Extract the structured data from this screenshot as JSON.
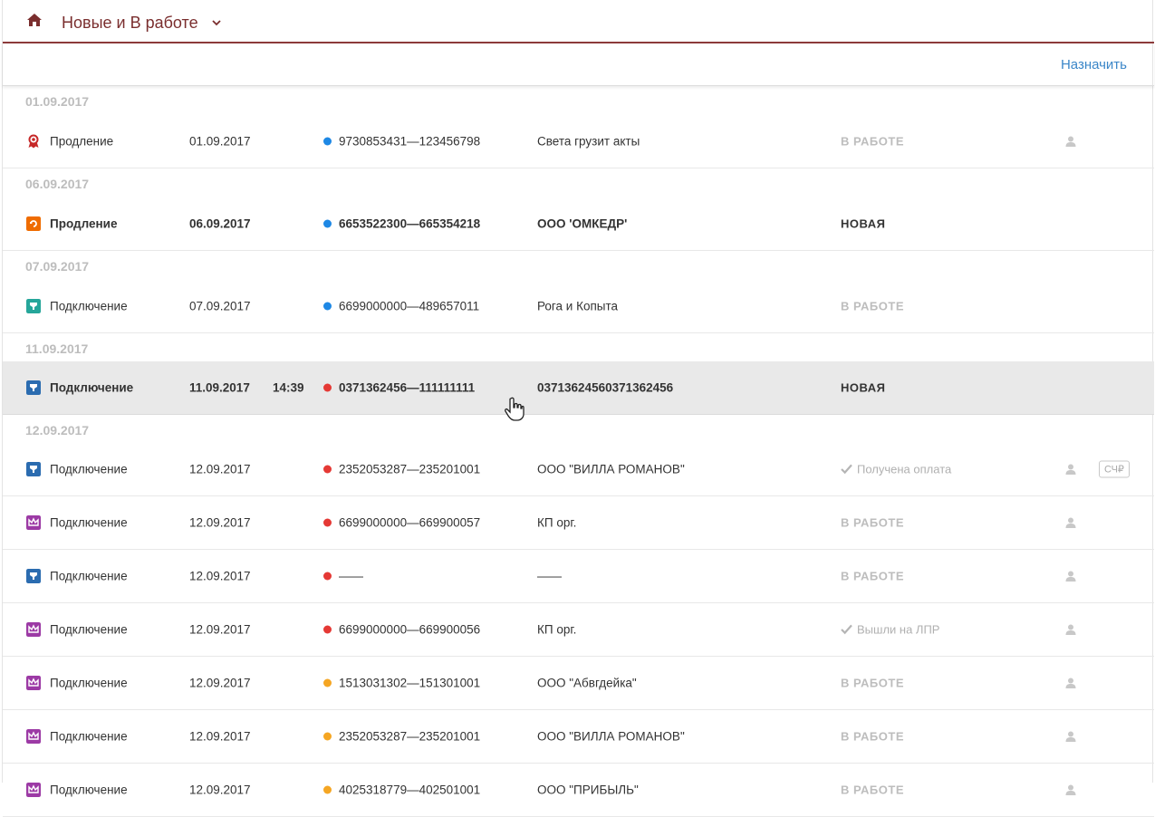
{
  "header": {
    "title": "Новые и В работе",
    "icons": [
      "home-icon",
      "chevron-down-icon"
    ]
  },
  "actions": {
    "assign_label": "Назначить"
  },
  "colors": {
    "brand": "#7a2e2e",
    "link": "#3a86c8",
    "dot_blue": "#1e88e5",
    "dot_red": "#e53935",
    "dot_orange": "#f5a623",
    "icon_red": "#c62828",
    "icon_orange": "#ef6c00",
    "icon_green": "#26a69a",
    "icon_blue": "#2b6cb0",
    "icon_purple": "#9c3aa5"
  },
  "groups": [
    {
      "date": "01.09.2017",
      "rows": [
        {
          "icon": "award-icon",
          "icon_color": "icon_red",
          "type": "Продление",
          "date": "01.09.2017",
          "time": "",
          "dot": "dot_blue",
          "inn": "9730853431—123456798",
          "org": "Света грузит акты",
          "status": "В РАБОТЕ",
          "status_kind": "work",
          "user": true,
          "badge": "",
          "bold": false,
          "selected": false
        }
      ]
    },
    {
      "date": "06.09.2017",
      "rows": [
        {
          "icon": "renew-icon",
          "icon_color": "icon_orange",
          "type": "Продление",
          "date": "06.09.2017",
          "time": "",
          "dot": "dot_blue",
          "inn": "6653522300—665354218",
          "org": "ООО 'ОМКЕДР'",
          "status": "НОВАЯ",
          "status_kind": "new",
          "user": false,
          "badge": "",
          "bold": true,
          "selected": false
        }
      ]
    },
    {
      "date": "07.09.2017",
      "rows": [
        {
          "icon": "connect-icon",
          "icon_color": "icon_green",
          "type": "Подключение",
          "date": "07.09.2017",
          "time": "",
          "dot": "dot_blue",
          "inn": "6699000000—489657011",
          "org": "Рога и Копыта",
          "status": "В РАБОТЕ",
          "status_kind": "work",
          "user": false,
          "badge": "",
          "bold": false,
          "selected": false
        }
      ]
    },
    {
      "date": "11.09.2017",
      "rows": [
        {
          "icon": "connect-icon",
          "icon_color": "icon_blue",
          "type": "Подключение",
          "date": "11.09.2017",
          "time": "14:39",
          "dot": "dot_red",
          "inn": "0371362456—111111111",
          "org": "03713624560371362456",
          "status": "НОВАЯ",
          "status_kind": "new",
          "user": false,
          "badge": "",
          "bold": true,
          "selected": true
        }
      ]
    },
    {
      "date": "12.09.2017",
      "rows": [
        {
          "icon": "connect-icon",
          "icon_color": "icon_blue",
          "type": "Подключение",
          "date": "12.09.2017",
          "time": "",
          "dot": "dot_red",
          "inn": "2352053287—235201001",
          "org": "ООО \"ВИЛЛА РОМАНОВ\"",
          "status": "Получена оплата",
          "status_kind": "done",
          "user": true,
          "badge": "СЧ₽",
          "bold": false,
          "selected": false
        },
        {
          "icon": "crown-icon",
          "icon_color": "icon_purple",
          "type": "Подключение",
          "date": "12.09.2017",
          "time": "",
          "dot": "dot_red",
          "inn": "6699000000—669900057",
          "org": "КП орг.",
          "status": "В РАБОТЕ",
          "status_kind": "work",
          "user": true,
          "badge": "",
          "bold": false,
          "selected": false
        },
        {
          "icon": "connect-icon",
          "icon_color": "icon_blue",
          "type": "Подключение",
          "date": "12.09.2017",
          "time": "",
          "dot": "dot_red",
          "inn": "——",
          "org": "——",
          "status": "В РАБОТЕ",
          "status_kind": "work",
          "user": true,
          "badge": "",
          "bold": false,
          "selected": false
        },
        {
          "icon": "crown-icon",
          "icon_color": "icon_purple",
          "type": "Подключение",
          "date": "12.09.2017",
          "time": "",
          "dot": "dot_red",
          "inn": "6699000000—669900056",
          "org": "КП орг.",
          "status": "Вышли на ЛПР",
          "status_kind": "done",
          "user": true,
          "badge": "",
          "bold": false,
          "selected": false
        },
        {
          "icon": "crown-icon",
          "icon_color": "icon_purple",
          "type": "Подключение",
          "date": "12.09.2017",
          "time": "",
          "dot": "dot_orange",
          "inn": "1513031302—151301001",
          "org": "ООО \"Абвгдейка\"",
          "status": "В РАБОТЕ",
          "status_kind": "work",
          "user": true,
          "badge": "",
          "bold": false,
          "selected": false
        },
        {
          "icon": "crown-icon",
          "icon_color": "icon_purple",
          "type": "Подключение",
          "date": "12.09.2017",
          "time": "",
          "dot": "dot_orange",
          "inn": "2352053287—235201001",
          "org": "ООО \"ВИЛЛА РОМАНОВ\"",
          "status": "В РАБОТЕ",
          "status_kind": "work",
          "user": true,
          "badge": "",
          "bold": false,
          "selected": false
        },
        {
          "icon": "crown-icon",
          "icon_color": "icon_purple",
          "type": "Подключение",
          "date": "12.09.2017",
          "time": "",
          "dot": "dot_orange",
          "inn": "4025318779—402501001",
          "org": "ООО \"ПРИБЫЛЬ\"",
          "status": "В РАБОТЕ",
          "status_kind": "work",
          "user": true,
          "badge": "",
          "bold": false,
          "selected": false
        }
      ]
    }
  ]
}
